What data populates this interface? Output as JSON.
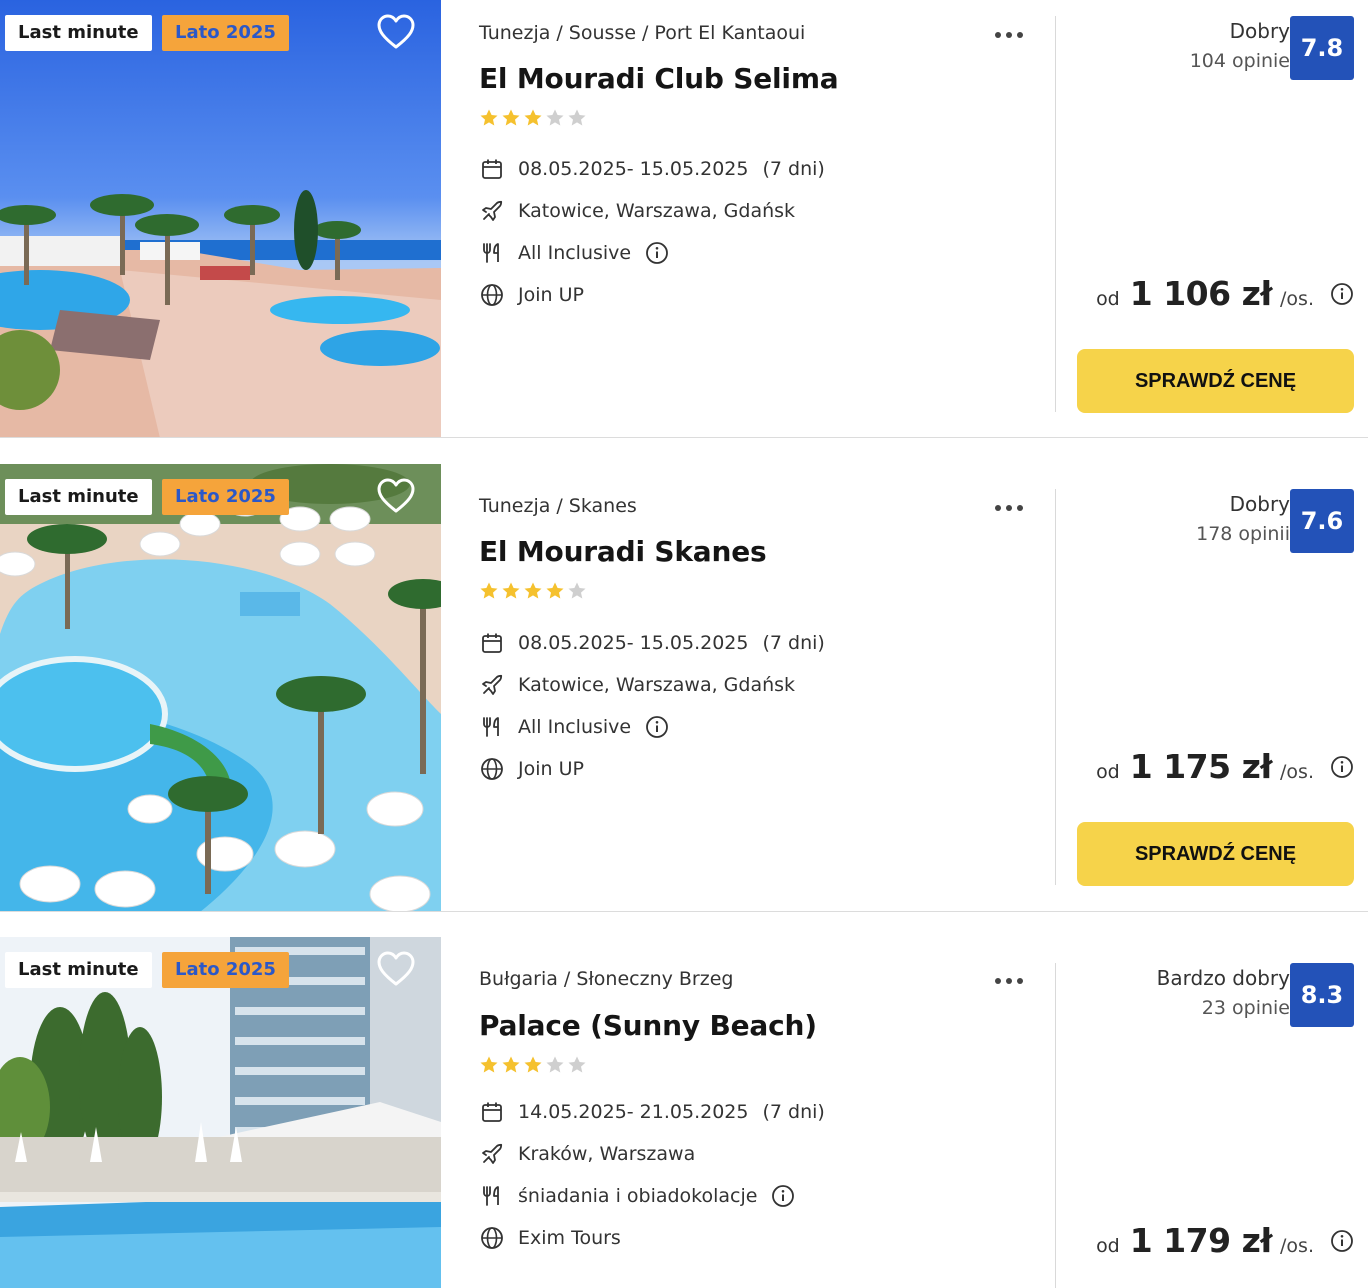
{
  "results": [
    {
      "badges": {
        "last_minute": "Last minute",
        "season": "Lato 2025"
      },
      "breadcrumb": [
        "Tunezja",
        "Sousse",
        "Port El Kantaoui"
      ],
      "name": "El Mouradi Club Selima",
      "stars": 3,
      "stars_max": 5,
      "dates": "08.05.2025- 15.05.2025",
      "duration": "(7 dni)",
      "departures": "Katowice, Warszawa, Gdańsk",
      "board": "All Inclusive",
      "operator": "Join UP",
      "rating_word": "Dobry",
      "reviews": "104 opinie",
      "score": "7.8",
      "price_prefix": "od",
      "price": "1 106 zł",
      "price_unit": "/os.",
      "cta": "SPRAWDŹ CENĘ"
    },
    {
      "badges": {
        "last_minute": "Last minute",
        "season": "Lato 2025"
      },
      "breadcrumb": [
        "Tunezja",
        "Skanes"
      ],
      "name": "El Mouradi Skanes",
      "stars": 4,
      "stars_max": 5,
      "dates": "08.05.2025- 15.05.2025",
      "duration": "(7 dni)",
      "departures": "Katowice, Warszawa, Gdańsk",
      "board": "All Inclusive",
      "operator": "Join UP",
      "rating_word": "Dobry",
      "reviews": "178 opinii",
      "score": "7.6",
      "price_prefix": "od",
      "price": "1 175 zł",
      "price_unit": "/os.",
      "cta": "SPRAWDŹ CENĘ"
    },
    {
      "badges": {
        "last_minute": "Last minute",
        "season": "Lato 2025"
      },
      "breadcrumb": [
        "Bułgaria",
        "Słoneczny Brzeg"
      ],
      "name": "Palace (Sunny Beach)",
      "stars": 3,
      "stars_max": 5,
      "dates": "14.05.2025- 21.05.2025",
      "duration": "(7 dni)",
      "departures": "Kraków, Warszawa",
      "board": "śniadania i obiadokolacje",
      "operator": "Exim Tours",
      "rating_word": "Bardzo dobry",
      "reviews": "23 opinie",
      "score": "8.3",
      "price_prefix": "od",
      "price": "1 179 zł",
      "price_unit": "/os."
    }
  ],
  "colors": {
    "score_bg": "#2352b8",
    "cta_bg": "#f6d34a",
    "season_badge_bg": "#f5a43b",
    "season_badge_text": "#2b58c8",
    "star_filled": "#f5c12e",
    "star_empty": "#cfcfcf"
  },
  "icons": {
    "favorite": "heart-outline-icon",
    "more": "more-dots-icon",
    "dates": "calendar-icon",
    "departures": "plane-icon",
    "board": "cutlery-icon",
    "operator": "globe-icon",
    "info": "info-circle-icon"
  }
}
